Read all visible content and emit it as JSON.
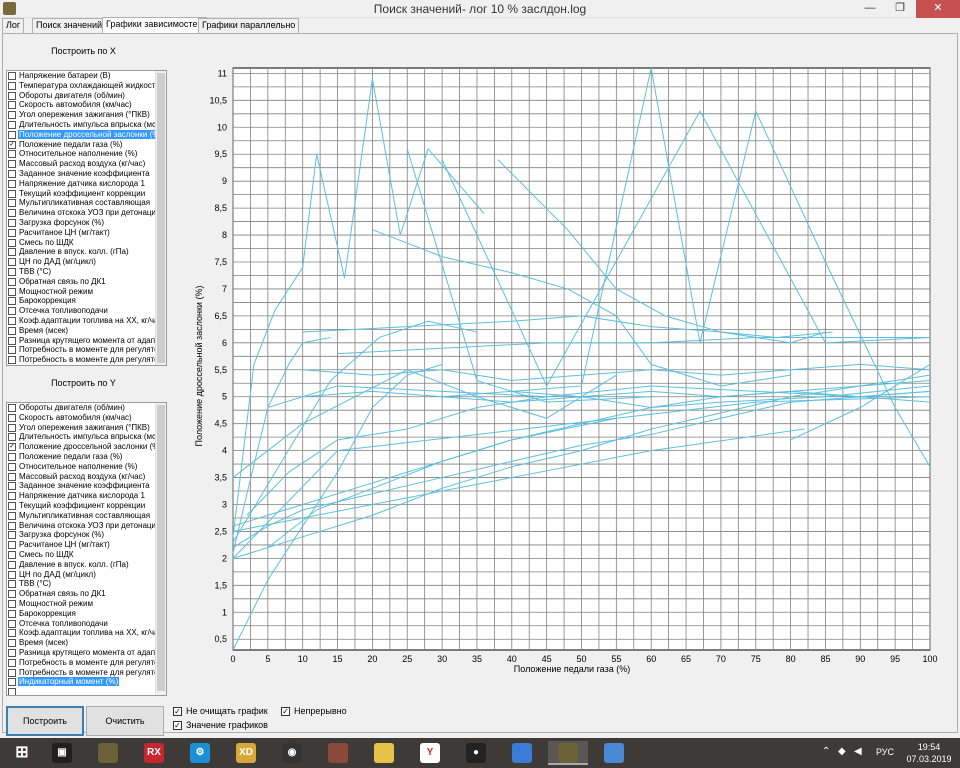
{
  "window": {
    "title": "Поиск значений- лог 10 % заслдон.log",
    "minimize": "—",
    "maximize": "❐",
    "close": "✕"
  },
  "tabs": [
    {
      "label": "Лог"
    },
    {
      "label": "Поиск значений"
    },
    {
      "label": "Графики зависимостей"
    },
    {
      "label": "Графики параллельно"
    }
  ],
  "x_panel": {
    "label": "Построить по X",
    "items": [
      {
        "label": "Напряжение батареи (В)",
        "checked": false,
        "selected": false
      },
      {
        "label": "Температура охлаждающей жидкости",
        "checked": false,
        "selected": false
      },
      {
        "label": "Обороты двигателя (об/мин)",
        "checked": false,
        "selected": false
      },
      {
        "label": "Скорость автомобиля (км/час)",
        "checked": false,
        "selected": false
      },
      {
        "label": "Угол опережения зажигания (°ПКВ)",
        "checked": false,
        "selected": false
      },
      {
        "label": "Длительность импульса впрыска (мс)",
        "checked": false,
        "selected": false
      },
      {
        "label": "Положение дроссельной заслонки (%)",
        "checked": false,
        "selected": true
      },
      {
        "label": "Положение педали газа (%)",
        "checked": true,
        "selected": false
      },
      {
        "label": "Относительное наполнение (%)",
        "checked": false,
        "selected": false
      },
      {
        "label": "Массовый расход воздуха (кг/час)",
        "checked": false,
        "selected": false
      },
      {
        "label": "Заданное значение коэффициента",
        "checked": false,
        "selected": false
      },
      {
        "label": "Напряжение датчика кислорода 1",
        "checked": false,
        "selected": false
      },
      {
        "label": "Текущий коэффициент коррекции",
        "checked": false,
        "selected": false
      },
      {
        "label": "Мультипликативная составляющая",
        "checked": false,
        "selected": false
      },
      {
        "label": "Величина отскока УОЗ при детонации",
        "checked": false,
        "selected": false
      },
      {
        "label": "Загрузка форсунок (%)",
        "checked": false,
        "selected": false
      },
      {
        "label": "Расчитаное ЦН (мг/такт)",
        "checked": false,
        "selected": false
      },
      {
        "label": "Смесь по ШДК",
        "checked": false,
        "selected": false
      },
      {
        "label": "Давление в впуск. колл. (гПа)",
        "checked": false,
        "selected": false
      },
      {
        "label": "ЦН по ДАД (мг/цикл)",
        "checked": false,
        "selected": false
      },
      {
        "label": "ТВВ (°С)",
        "checked": false,
        "selected": false
      },
      {
        "label": "Обратная связь по ДК1",
        "checked": false,
        "selected": false
      },
      {
        "label": "Мощностной режим",
        "checked": false,
        "selected": false
      },
      {
        "label": "Барокоррекция",
        "checked": false,
        "selected": false
      },
      {
        "label": "Отсечка топливоподачи",
        "checked": false,
        "selected": false
      },
      {
        "label": "Коэф.адаптации топлива на ХХ, кг/час",
        "checked": false,
        "selected": false
      },
      {
        "label": "Время (мсек)",
        "checked": false,
        "selected": false
      },
      {
        "label": "Разница крутящего момента от адаптации",
        "checked": false,
        "selected": false
      },
      {
        "label": "Потребность в моменте для регулятора",
        "checked": false,
        "selected": false
      },
      {
        "label": "Потребность в моменте для регулятора",
        "checked": false,
        "selected": false
      }
    ]
  },
  "y_panel": {
    "label": "Построить по Y",
    "items": [
      {
        "label": "Обороты двигателя (об/мин)",
        "checked": false,
        "selected": false
      },
      {
        "label": "Скорость автомобиля (км/час)",
        "checked": false,
        "selected": false
      },
      {
        "label": "Угол опережения зажигания (°ПКВ)",
        "checked": false,
        "selected": false
      },
      {
        "label": "Длительность импульса впрыска (мс)",
        "checked": false,
        "selected": false
      },
      {
        "label": "Положение дроссельной заслонки (%)",
        "checked": true,
        "selected": false
      },
      {
        "label": "Положение педали газа (%)",
        "checked": false,
        "selected": false
      },
      {
        "label": "Относительное наполнение (%)",
        "checked": false,
        "selected": false
      },
      {
        "label": "Массовый расход воздуха (кг/час)",
        "checked": false,
        "selected": false
      },
      {
        "label": "Заданное значение коэффициента",
        "checked": false,
        "selected": false
      },
      {
        "label": "Напряжение датчика кислорода 1",
        "checked": false,
        "selected": false
      },
      {
        "label": "Текущий коэффициент коррекции",
        "checked": false,
        "selected": false
      },
      {
        "label": "Мультипликативная составляющая",
        "checked": false,
        "selected": false
      },
      {
        "label": "Величина отскока УОЗ при детонации",
        "checked": false,
        "selected": false
      },
      {
        "label": "Загрузка форсунок (%)",
        "checked": false,
        "selected": false
      },
      {
        "label": "Расчитаное ЦН (мг/такт)",
        "checked": false,
        "selected": false
      },
      {
        "label": "Смесь по ШДК",
        "checked": false,
        "selected": false
      },
      {
        "label": "Давление в впуск. колл. (гПа)",
        "checked": false,
        "selected": false
      },
      {
        "label": "ЦН по ДАД (мг/цикл)",
        "checked": false,
        "selected": false
      },
      {
        "label": "ТВВ (°С)",
        "checked": false,
        "selected": false
      },
      {
        "label": "Обратная связь по ДК1",
        "checked": false,
        "selected": false
      },
      {
        "label": "Мощностной режим",
        "checked": false,
        "selected": false
      },
      {
        "label": "Барокоррекция",
        "checked": false,
        "selected": false
      },
      {
        "label": "Отсечка топливоподачи",
        "checked": false,
        "selected": false
      },
      {
        "label": "Коэф.адаптации топлива на ХХ, кг/час",
        "checked": false,
        "selected": false
      },
      {
        "label": "Время (мсек)",
        "checked": false,
        "selected": false
      },
      {
        "label": "Разница крутящего момента от адаптации",
        "checked": false,
        "selected": false
      },
      {
        "label": "Потребность в моменте для регулятора",
        "checked": false,
        "selected": false
      },
      {
        "label": "Потребность в моменте для регулятора",
        "checked": false,
        "selected": false
      },
      {
        "label": "Индикаторный момент (%)",
        "checked": false,
        "selected": true
      },
      {
        "label": "",
        "checked": false,
        "selected": false
      }
    ]
  },
  "buttons": {
    "build": "Построить",
    "clear": "Очистить"
  },
  "options": {
    "no_clear": {
      "label": "Не очищать график",
      "checked": true
    },
    "values": {
      "label": "Значение графиков",
      "checked": true
    },
    "continuous": {
      "label": "Непрерывно",
      "checked": true
    }
  },
  "chart_data": {
    "type": "line",
    "xlabel": "Положение педали газа (%)",
    "ylabel": "Положение дроссельной заслонки (%)",
    "xlim": [
      0,
      100
    ],
    "ylim": [
      0.3,
      11.1
    ],
    "x_ticks": [
      "0",
      "5",
      "10",
      "15",
      "20",
      "25",
      "30",
      "35",
      "40",
      "45",
      "50",
      "55",
      "60",
      "65",
      "70",
      "75",
      "80",
      "85",
      "90",
      "95",
      "100"
    ],
    "y_ticks": [
      "0,5",
      "1",
      "1,5",
      "2",
      "2,5",
      "3",
      "3,5",
      "4",
      "4,5",
      "5",
      "5,5",
      "6",
      "6,5",
      "7",
      "7,5",
      "8",
      "8,5",
      "9",
      "9,5",
      "10",
      "10,5",
      "11"
    ],
    "y_tick_values": [
      0.5,
      1,
      1.5,
      2,
      2.5,
      3,
      3.5,
      4,
      4.5,
      5,
      5.5,
      6,
      6.5,
      7,
      7.5,
      8,
      8.5,
      9,
      9.5,
      10,
      10.5,
      11
    ],
    "grid": true,
    "color": "#5bc0de",
    "series": [
      {
        "x": [
          0,
          5,
          10,
          15,
          20,
          25,
          30
        ],
        "y": [
          0.3,
          1.6,
          2.6,
          3.6,
          4.8,
          5.4,
          5.6
        ]
      },
      {
        "x": [
          0,
          2,
          5,
          8,
          10,
          14
        ],
        "y": [
          2.1,
          3.2,
          4.8,
          5.6,
          6.0,
          6.1
        ]
      },
      {
        "x": [
          0,
          3,
          6,
          10,
          12,
          16,
          20
        ],
        "y": [
          2.4,
          5.6,
          6.6,
          7.4,
          9.5,
          7.2,
          10.9
        ]
      },
      {
        "x": [
          20,
          24,
          28,
          32,
          36
        ],
        "y": [
          10.9,
          8.0,
          9.6,
          9.0,
          8.4
        ]
      },
      {
        "x": [
          0,
          5,
          10,
          20,
          30,
          40,
          50,
          60,
          70,
          80,
          90,
          100
        ],
        "y": [
          2.2,
          2.6,
          2.9,
          3.2,
          3.5,
          3.8,
          4.1,
          4.3,
          4.6,
          4.9,
          5.0,
          5.1
        ]
      },
      {
        "x": [
          0,
          10,
          20,
          30,
          40,
          50,
          60,
          70,
          80,
          90,
          100
        ],
        "y": [
          2.0,
          2.4,
          2.8,
          3.3,
          3.7,
          4.0,
          4.4,
          4.7,
          5.0,
          5.2,
          5.4
        ]
      },
      {
        "x": [
          0,
          10,
          20,
          30,
          40,
          50,
          60,
          70,
          80,
          90,
          100
        ],
        "y": [
          2.6,
          3.0,
          3.4,
          3.8,
          4.2,
          4.5,
          4.8,
          5.0,
          5.1,
          5.2,
          5.3
        ]
      },
      {
        "x": [
          10,
          20,
          30,
          40,
          50,
          60,
          70,
          80,
          90,
          100
        ],
        "y": [
          5.0,
          5.1,
          5.0,
          5.1,
          5.0,
          5.1,
          5.0,
          5.1,
          5.0,
          5.1
        ]
      },
      {
        "x": [
          10,
          20,
          30,
          40,
          50,
          60,
          70,
          80,
          90,
          100
        ],
        "y": [
          5.5,
          5.4,
          5.5,
          5.3,
          5.4,
          5.5,
          5.4,
          5.5,
          5.6,
          5.5
        ]
      },
      {
        "x": [
          15,
          30,
          45,
          60,
          75,
          90,
          100
        ],
        "y": [
          5.8,
          5.9,
          6.0,
          6.0,
          6.1,
          6.1,
          6.1
        ]
      },
      {
        "x": [
          5,
          15,
          30,
          45,
          60,
          75,
          90,
          100
        ],
        "y": [
          4.8,
          5.2,
          5.1,
          5.0,
          5.2,
          5.1,
          5.0,
          4.9
        ]
      },
      {
        "x": [
          10,
          25,
          40,
          50,
          60,
          70,
          80,
          85
        ],
        "y": [
          6.2,
          6.3,
          6.4,
          6.5,
          6.3,
          6.2,
          6.0,
          6.2
        ]
      },
      {
        "x": [
          30,
          40,
          50,
          60,
          70,
          85,
          100
        ],
        "y": [
          5.0,
          4.9,
          5.0,
          4.8,
          4.9,
          5.0,
          5.2
        ]
      },
      {
        "x": [
          40,
          50,
          60,
          67,
          75,
          85,
          95,
          100
        ],
        "y": [
          5.1,
          5.2,
          11.1,
          6.0,
          10.3,
          7.5,
          4.8,
          3.7
        ]
      },
      {
        "x": [
          30,
          45,
          67,
          85,
          100
        ],
        "y": [
          9.4,
          5.2,
          10.3,
          6.0,
          6.1
        ]
      },
      {
        "x": [
          0,
          10,
          25,
          35,
          45,
          55
        ],
        "y": [
          3.5,
          4.5,
          5.5,
          5.0,
          4.6,
          5.4
        ]
      },
      {
        "x": [
          2,
          8,
          15,
          25,
          35,
          45
        ],
        "y": [
          2.8,
          3.6,
          4.2,
          4.4,
          4.8,
          5.0
        ]
      },
      {
        "x": [
          5,
          12,
          20,
          30,
          40,
          55
        ],
        "y": [
          2.2,
          2.9,
          3.3,
          3.8,
          4.2,
          4.6
        ]
      },
      {
        "x": [
          0,
          7,
          14,
          21,
          28,
          35
        ],
        "y": [
          2.3,
          3.8,
          5.3,
          6.1,
          6.4,
          6.2
        ]
      },
      {
        "x": [
          20,
          30,
          40,
          48,
          55,
          60,
          70,
          80
        ],
        "y": [
          8.1,
          7.6,
          7.3,
          7.0,
          6.5,
          5.6,
          5.2,
          5.4
        ]
      },
      {
        "x": [
          25,
          35,
          45,
          60
        ],
        "y": [
          9.6,
          5.3,
          4.9,
          5.0
        ]
      },
      {
        "x": [
          38,
          48,
          55,
          62,
          70,
          78,
          86
        ],
        "y": [
          9.4,
          8.1,
          7.0,
          6.5,
          6.2,
          6.1,
          6.2
        ]
      },
      {
        "x": [
          80,
          90,
          100
        ],
        "y": [
          4.2,
          4.8,
          5.6
        ]
      },
      {
        "x": [
          0,
          15,
          35,
          55,
          75,
          100
        ],
        "y": [
          2.0,
          4.0,
          4.3,
          4.6,
          4.9,
          5.0
        ]
      },
      {
        "x": [
          0,
          20,
          40,
          60,
          82
        ],
        "y": [
          2.5,
          3.0,
          3.5,
          4.0,
          4.4
        ]
      }
    ]
  },
  "taskbar": {
    "items": [
      {
        "icon": "windows-start-icon",
        "label": ""
      },
      {
        "icon": "terminal-app-icon",
        "label": "▣"
      },
      {
        "icon": "yoda-app-icon",
        "label": ""
      },
      {
        "icon": "rx-app-icon",
        "label": "RX"
      },
      {
        "icon": "gear-app-icon",
        "label": "⚙"
      },
      {
        "icon": "xd-app-icon",
        "label": "XD"
      },
      {
        "icon": "gauge-app-icon",
        "label": "◉"
      },
      {
        "icon": "photo-app-icon",
        "label": ""
      },
      {
        "icon": "folder-icon",
        "label": ""
      },
      {
        "icon": "yandex-browser-icon",
        "label": "Y"
      },
      {
        "icon": "record-app-icon",
        "label": "●"
      },
      {
        "icon": "network-app-icon",
        "label": ""
      },
      {
        "icon": "yoda-app-icon",
        "label": ""
      },
      {
        "icon": "paint-app-icon",
        "label": ""
      }
    ],
    "colors": [
      "#3e3a38",
      "#1f1f1f",
      "#6b6238",
      "#c6262e",
      "#1c8fd6",
      "#d8a938",
      "#333333",
      "#8a4a3a",
      "#e6c24a",
      "#ffffff",
      "#222222",
      "#3a7bd5",
      "#6b6238",
      "#4a8ad4"
    ],
    "lang": "РУС",
    "time": "19:54",
    "date": "07.03.2019"
  }
}
